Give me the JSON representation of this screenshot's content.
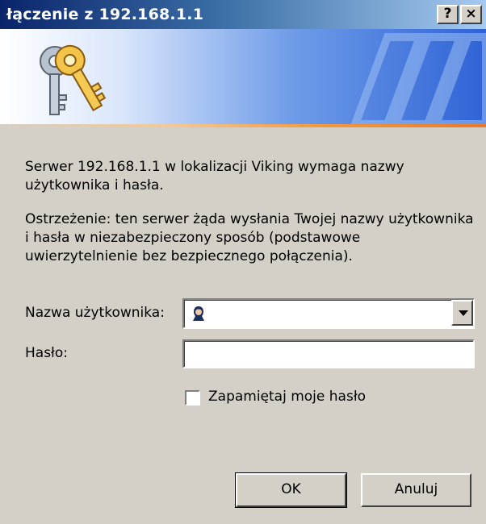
{
  "window": {
    "title": "łączenie z 192.168.1.1",
    "help_button": "?",
    "close_button": "×"
  },
  "message": {
    "line1": "Serwer 192.168.1.1 w lokalizacji Viking wymaga nazwy użytkownika i hasła.",
    "warning": "Ostrzeżenie: ten serwer żąda wysłania Twojej nazwy użytkownika i hasła w niezabezpieczony sposób (podstawowe uwierzytelnienie bez bezpiecznego połączenia)."
  },
  "form": {
    "username_label": "Nazwa użytkownika:",
    "username_value": "",
    "password_label": "Hasło:",
    "password_value": "",
    "remember_label": "Zapamiętaj moje hasło",
    "remember_checked": false
  },
  "buttons": {
    "ok": "OK",
    "cancel": "Anuluj"
  },
  "icons": {
    "banner": "keys-icon",
    "user": "user-icon",
    "dropdown": "chevron-down-icon"
  }
}
